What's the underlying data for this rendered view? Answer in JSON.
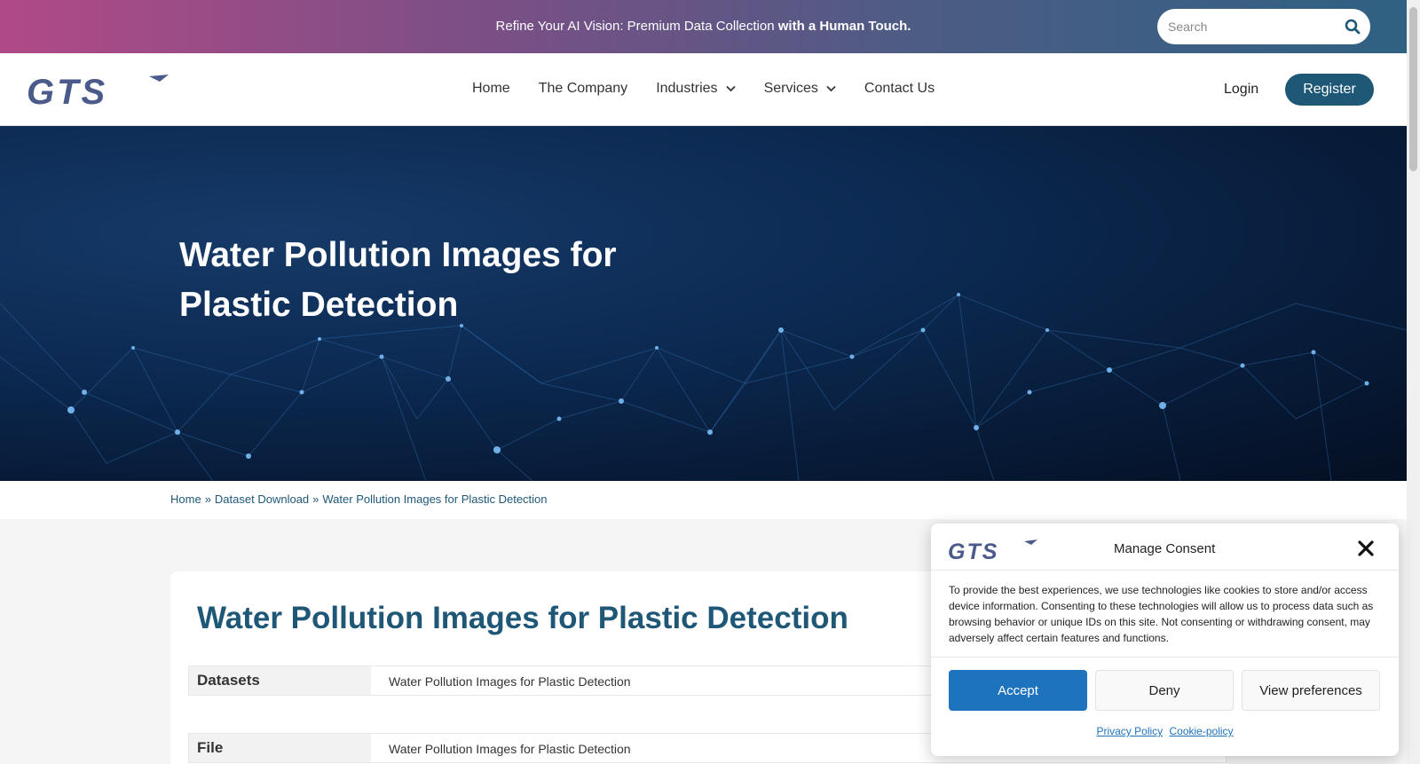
{
  "topbar": {
    "promo_text": "Refine Your AI Vision: Premium Data Collection",
    "promo_bold": "with a Human Touch.",
    "search_placeholder": "Search"
  },
  "nav": {
    "logo_text": "GTS",
    "items": [
      {
        "label": "Home"
      },
      {
        "label": "The Company"
      },
      {
        "label": "Industries",
        "dropdown": true
      },
      {
        "label": "Services",
        "dropdown": true
      },
      {
        "label": "Contact Us"
      }
    ],
    "login": "Login",
    "register": "Register"
  },
  "hero": {
    "title": "Water Pollution Images for Plastic Detection"
  },
  "breadcrumb": {
    "items": [
      "Home",
      "Dataset Download",
      "Water Pollution Images for Plastic Detection"
    ],
    "separator": "»"
  },
  "content": {
    "title": "Water Pollution Images for Plastic Detection",
    "rows": [
      {
        "label": "Datasets",
        "value": "Water Pollution Images for Plastic Detection"
      },
      {
        "label": "File",
        "value": "Water Pollution Images for Plastic Detection"
      }
    ]
  },
  "consent": {
    "title": "Manage Consent",
    "body": "To provide the best experiences, we use technologies like cookies to store and/or access device information. Consenting to these technologies will allow us to process data such as browsing behavior or unique IDs on this site. Not consenting or withdrawing consent, may adversely affect certain features and functions.",
    "accept": "Accept",
    "deny": "Deny",
    "view_preferences": "View preferences",
    "privacy_policy": "Privacy Policy",
    "cookie_policy": "Cookie-policy"
  },
  "colors": {
    "brand": "#1f5777",
    "accept": "#1e73be",
    "logo": "#4a5a8a"
  }
}
